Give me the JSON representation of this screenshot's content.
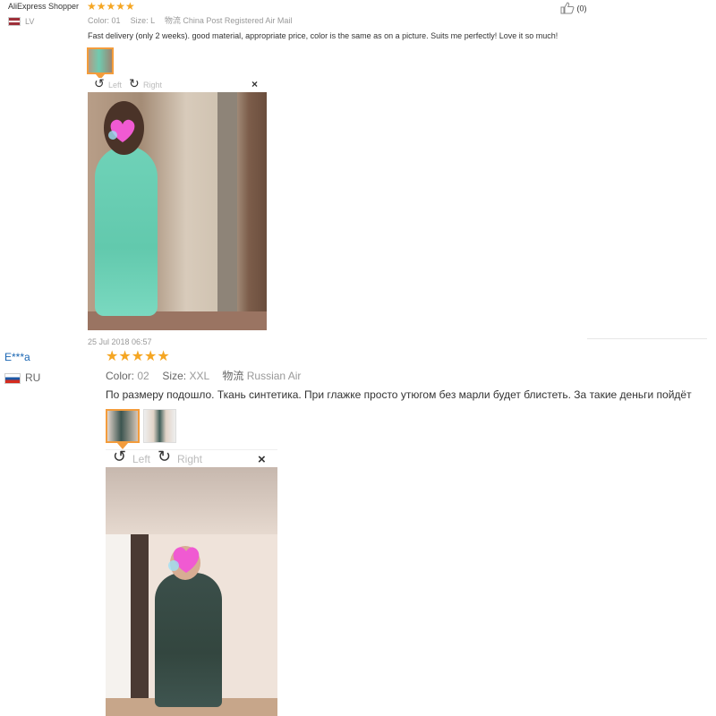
{
  "review1": {
    "user": "AliExpress Shopper",
    "stars": "★★★★★",
    "country": "LV",
    "color_label": "Color:",
    "color_value": "01",
    "size_label": "Size:",
    "size_value": "L",
    "shipping_label": "物流",
    "shipping_value": "China Post Registered Air Mail",
    "text": "Fast delivery (only 2 weeks). good material, appropriate price, color is the same as on a picture. Suits me perfectly! Love it so much!",
    "helpful": "(0)",
    "rotate_left": "Left",
    "rotate_right": "Right",
    "close": "×",
    "date": "25 Jul 2018 06:57"
  },
  "review2": {
    "user": "E***a",
    "stars": "★★★★★",
    "country": "RU",
    "color_label": "Color:",
    "color_value": "02",
    "size_label": "Size:",
    "size_value": "XXL",
    "shipping_label": "物流",
    "shipping_value": "Russian Air",
    "text": "По размеру подошло. Ткань синтетика. При глажке просто утюгом без марли будет блистеть. За такие деньги пойдёт",
    "rotate_left": "Left",
    "rotate_right": "Right",
    "close": "×"
  },
  "colors": {
    "accent": "#f5a623",
    "thumb_active": "#f39c3c",
    "link": "#1a66b3"
  }
}
